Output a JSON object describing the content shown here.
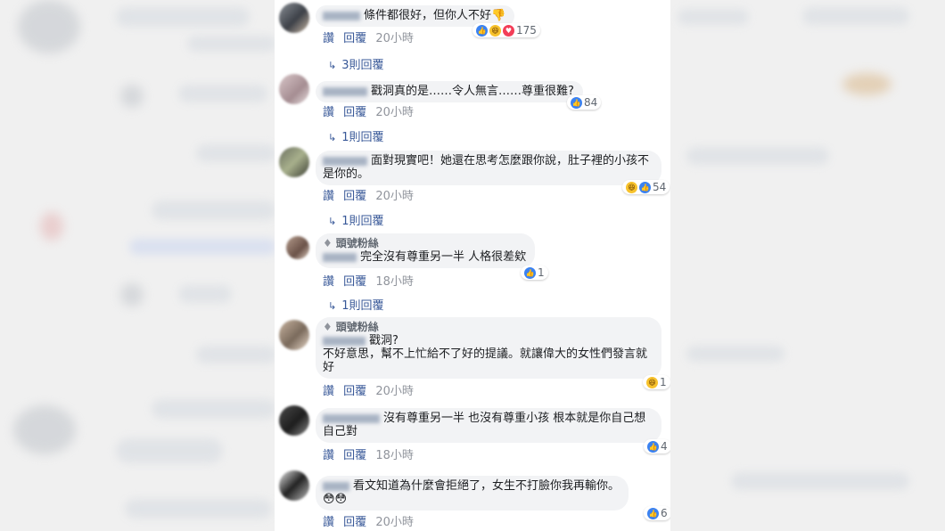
{
  "actions": {
    "like": "讚",
    "reply": "回覆"
  },
  "comments": [
    {
      "text": "條件都很好，但你人不好",
      "time": "20小時",
      "reactions": [
        "like",
        "haha",
        "love"
      ],
      "count": "175",
      "replies": "3則回覆"
    },
    {
      "text": "戳洞真的是……令人無言……尊重很難?",
      "time": "20小時",
      "reactions": [
        "like"
      ],
      "count": "84",
      "replies": "1則回覆"
    },
    {
      "text": "面對現實吧！她還在思考怎麼跟你說，肚子裡的小孩不是你的。",
      "time": "20小時",
      "reactions": [
        "haha",
        "like"
      ],
      "count": "54",
      "replies": "1則回覆"
    },
    {
      "badge": "頭號粉絲",
      "text": "完全沒有尊重另一半 人格很差欸",
      "time": "18小時",
      "reactions": [
        "like"
      ],
      "count": "1",
      "replies": "1則回覆"
    },
    {
      "badge": "頭號粉絲",
      "text": "戳洞?",
      "text2": "不好意思，幫不上忙給不了好的提議。就讓偉大的女性們發言就好",
      "time": "20小時",
      "reactions": [
        "haha"
      ],
      "count": "1"
    },
    {
      "text": "沒有尊重另一半 也沒有尊重小孩 根本就是你自己想自己對",
      "time": "18小時",
      "reactions": [
        "like"
      ],
      "count": "4"
    },
    {
      "text": "看文知道為什麼會拒絕了，女生不打臉你我再輸你。",
      "emoji": "😳😳",
      "time": "20小時",
      "reactions": [
        "like"
      ],
      "count": "6"
    }
  ]
}
